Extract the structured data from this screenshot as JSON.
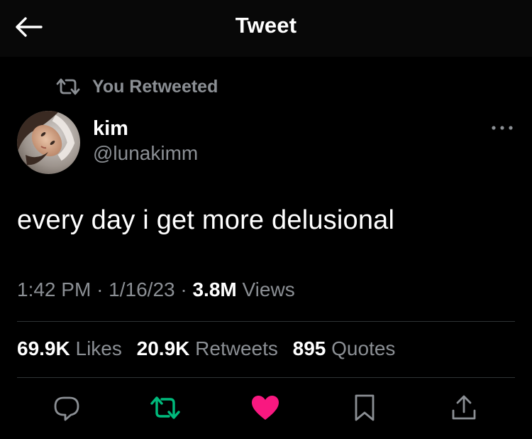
{
  "header": {
    "title": "Tweet",
    "back_icon": "arrow-left-icon"
  },
  "retweet_context": {
    "text": "You Retweeted",
    "icon": "retweet-icon"
  },
  "author": {
    "display_name": "kim",
    "handle": "@lunakimm"
  },
  "tweet": {
    "text": "every day i get more delusional"
  },
  "meta": {
    "time": "1:42 PM",
    "separator": "·",
    "date": "1/16/23",
    "views_count": "3.8M",
    "views_label": "Views"
  },
  "stats": {
    "likes_count": "69.9K",
    "likes_label": "Likes",
    "retweets_count": "20.9K",
    "retweets_label": "Retweets",
    "quotes_count": "895",
    "quotes_label": "Quotes"
  },
  "actions": [
    {
      "name": "reply",
      "icon": "reply-icon",
      "color": "#8b8f94",
      "active": false
    },
    {
      "name": "retweet",
      "icon": "retweet-icon",
      "color": "#00ba7c",
      "active": true
    },
    {
      "name": "like",
      "icon": "heart-icon",
      "color": "#f91880",
      "active": true
    },
    {
      "name": "bookmark",
      "icon": "bookmark-icon",
      "color": "#8b8f94",
      "active": false
    },
    {
      "name": "share",
      "icon": "share-icon",
      "color": "#8b8f94",
      "active": false
    }
  ],
  "colors": {
    "background": "#000000",
    "text_primary": "#ffffff",
    "text_secondary": "#8b8f94",
    "divider": "#2f3336",
    "retweet_active": "#00ba7c",
    "like_active": "#f91880"
  }
}
